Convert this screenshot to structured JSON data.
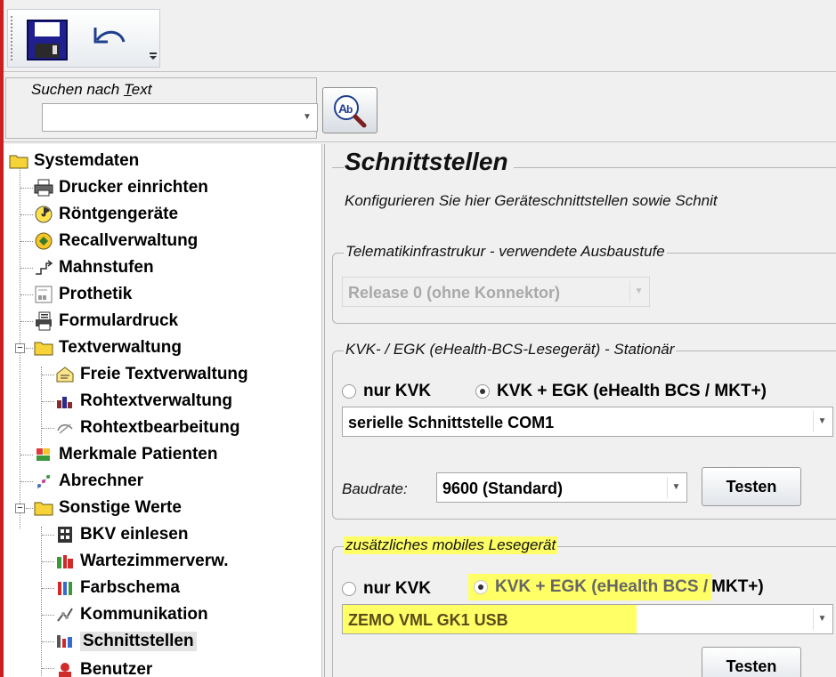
{
  "toolbar": {
    "save_icon": "floppy-disk-icon",
    "undo_icon": "undo-arrow-icon",
    "overflow_icon": "toolbar-overflow-icon"
  },
  "search": {
    "label_prefix": "Suchen nach ",
    "label_accel": "T",
    "label_suffix": "ext",
    "value": "",
    "button_icon": "text-search-icon"
  },
  "tree": {
    "items": [
      {
        "label": "Systemdaten",
        "icon": "folder-icon"
      },
      {
        "label": "Drucker einrichten",
        "icon": "printer-icon"
      },
      {
        "label": "Röntgengeräte",
        "icon": "radiation-icon"
      },
      {
        "label": "Recallverwaltung",
        "icon": "recall-icon"
      },
      {
        "label": "Mahnstufen",
        "icon": "steps-icon"
      },
      {
        "label": "Prothetik",
        "icon": "prosthetics-icon"
      },
      {
        "label": "Formulardruck",
        "icon": "form-print-icon"
      },
      {
        "label": "Textverwaltung",
        "icon": "folder-icon"
      },
      {
        "label": "Freie Textverwaltung",
        "icon": "free-text-icon"
      },
      {
        "label": "Rohtextverwaltung",
        "icon": "raw-text-icon"
      },
      {
        "label": "Rohtextbearbeitung",
        "icon": "raw-text-edit-icon"
      },
      {
        "label": "Merkmale Patienten",
        "icon": "patient-features-icon"
      },
      {
        "label": "Abrechner",
        "icon": "billing-icon"
      },
      {
        "label": "Sonstige Werte",
        "icon": "folder-icon"
      },
      {
        "label": "BKV einlesen",
        "icon": "bkv-icon"
      },
      {
        "label": "Wartezimmerverw.",
        "icon": "waiting-room-icon"
      },
      {
        "label": "Farbschema",
        "icon": "color-scheme-icon"
      },
      {
        "label": "Kommunikation",
        "icon": "communication-icon"
      },
      {
        "label": "Schnittstellen",
        "icon": "interfaces-icon"
      },
      {
        "label": "Benutzer",
        "icon": "user-icon"
      }
    ]
  },
  "panel": {
    "title": "Schnittstellen",
    "description": "Konfigurieren Sie hier Geräteschnittstellen sowie Schnit",
    "ti_group": {
      "legend": "Telematikinfrastrukur - verwendete Ausbaustufe",
      "combo_value": "Release 0 (ohne Konnektor)"
    },
    "kvk_group": {
      "legend": "KVK- / EGK (eHealth-BCS-Lesegerät) - Stationär",
      "radio_kvk": "nur KVK",
      "radio_egk": "KVK + EGK (eHealth BCS / MKT+)",
      "port_value": "serielle Schnittstelle COM1",
      "baud_label": "Baudrate:",
      "baud_value": "9600 (Standard)",
      "test_button": "Testen"
    },
    "mobile_group": {
      "legend": "zusätzliches mobiles Lesegerät",
      "radio_kvk": "nur KVK",
      "radio_egk_a": "KVK + EGK (eHealth BCS /",
      "radio_egk_b": " MKT+)",
      "device_value": "ZEMO VML GK1 USB",
      "test_button": "Testen"
    }
  },
  "colors": {
    "highlight": "#ffff66",
    "left_edge": "#cc2020"
  }
}
